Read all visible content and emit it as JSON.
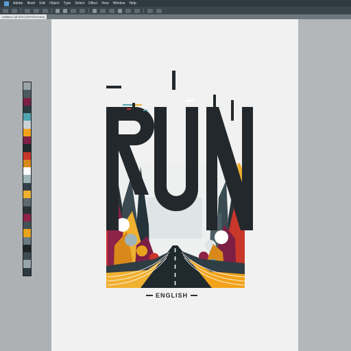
{
  "app": {
    "menu": [
      "Adobe",
      "Illustr",
      "Edit",
      "Object",
      "Type",
      "Select",
      "Effect",
      "View",
      "Window",
      "Help"
    ]
  },
  "document": {
    "tab_label": "Untitled-1 @ 50% (CMYK/Preview)"
  },
  "swatch_colors": [
    "#9aa3a6",
    "#4b5a60",
    "#7d1f45",
    "#2c3a40",
    "#4fa3b0",
    "#c9d1d4",
    "#f2a31b",
    "#7d1f45",
    "#1f2a2f",
    "#c7362a",
    "#d8891a",
    "#ffffff",
    "#9fb4b8",
    "#334048",
    "#f0b030",
    "#5d6a70",
    "#2a3236",
    "#8e2247",
    "#435158",
    "#e8a21c",
    "#6a7a80",
    "#1c2528",
    "#3e4c52",
    "#97a6ab",
    "#2d3a40"
  ],
  "poster": {
    "title": "RUN",
    "caption": "ENGLISH"
  }
}
